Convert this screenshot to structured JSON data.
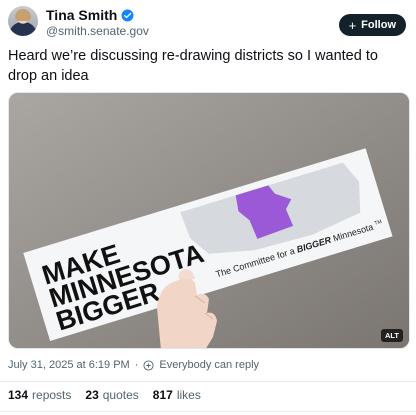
{
  "author": {
    "name": "Tina Smith",
    "handle": "@smith.senate.gov",
    "verified_color": "#1185fe"
  },
  "follow_button": {
    "label": "Follow",
    "icon": "plus-icon"
  },
  "post": {
    "text": "Heard we’re discussing re-drawing districts so I wanted to drop an idea",
    "image": {
      "alt_badge": "ALT",
      "sticker_line1": "MAKE",
      "sticker_line2": "MINNESOTA",
      "sticker_line3": "BIGGER",
      "tagline_prefix": "The Committee for a",
      "tagline_bold": "BIGGER",
      "tagline_suffix": "Minnesota",
      "tagline_tm": "TM",
      "highlight_color": "#9b59d8"
    }
  },
  "meta": {
    "timestamp": "July 31, 2025 at 6:19 PM",
    "separator": "·",
    "reply_setting": "Everybody can reply"
  },
  "stats": [
    {
      "count": "134",
      "label": "reposts"
    },
    {
      "count": "23",
      "label": "quotes"
    },
    {
      "count": "817",
      "label": "likes"
    }
  ]
}
